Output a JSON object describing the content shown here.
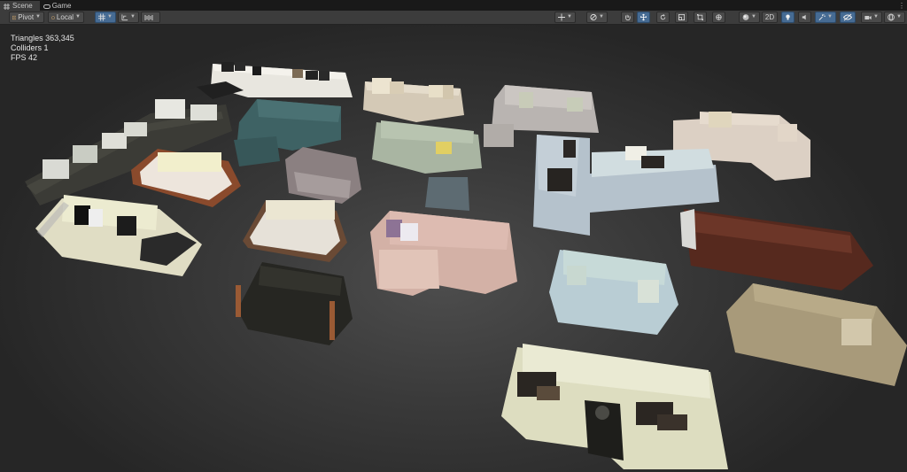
{
  "tabs": [
    {
      "label": "Scene",
      "icon": "hash-icon",
      "active": true
    },
    {
      "label": "Game",
      "icon": "gamepad-icon",
      "active": false
    }
  ],
  "toolbar": {
    "pivot_label": "Pivot",
    "local_label": "Local",
    "mode_2d_label": "2D",
    "accent_color": "#466b93"
  },
  "stats": {
    "triangles": "Triangles 363,345",
    "colliders": "Colliders 1",
    "fps": "FPS 42"
  }
}
